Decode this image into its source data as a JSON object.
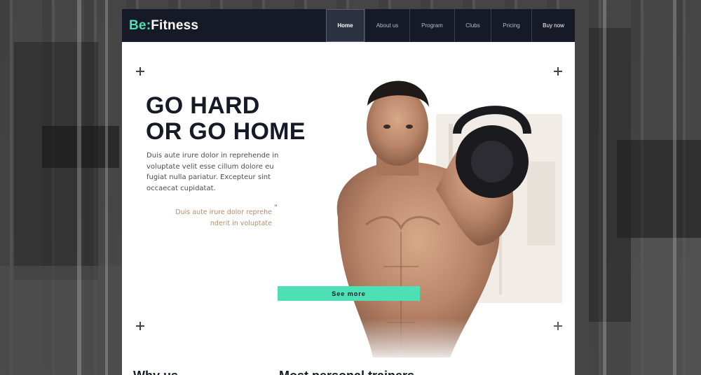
{
  "brand": {
    "prefix": "Be:",
    "name": "Fitness"
  },
  "nav": {
    "items": [
      {
        "label": "Home",
        "active": true
      },
      {
        "label": "About us",
        "active": false
      },
      {
        "label": "Program",
        "active": false
      },
      {
        "label": "Clubs",
        "active": false
      },
      {
        "label": "Pricing",
        "active": false
      },
      {
        "label": "Buy now",
        "active": false
      }
    ]
  },
  "hero": {
    "headline_line1": "GO HARD",
    "headline_line2": "OR GO HOME",
    "intro": "Duis aute irure dolor in reprehende in voluptate velit esse cillum dolore eu fugiat nulla pariatur. Excepteur sint occaecat cupidatat.",
    "quote": "Duis aute irure dolor reprehe nderit in voluptate",
    "quote_mark": "\"",
    "button_label": "See more"
  },
  "sections": {
    "why_us": "Why us",
    "trainers": "Most personal trainers"
  },
  "colors": {
    "nav_bg": "#161a27",
    "accent": "#4de0b4",
    "quote": "#b58d6a",
    "headline": "#161a27"
  }
}
